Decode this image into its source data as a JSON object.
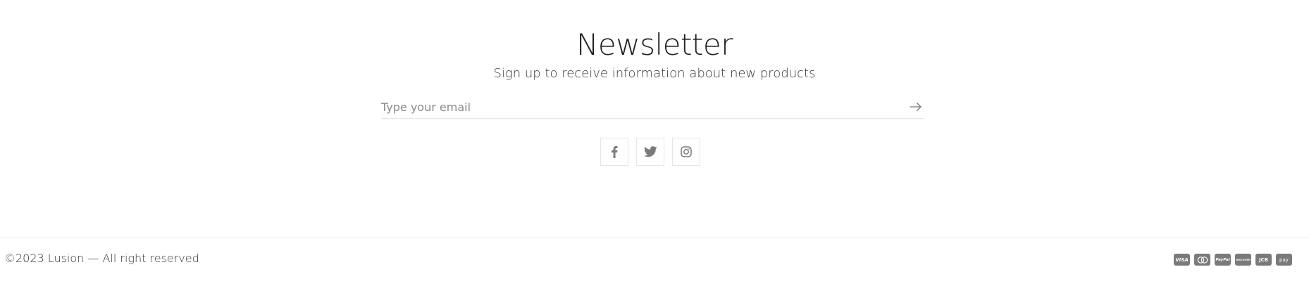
{
  "newsletter": {
    "title": "Newsletter",
    "subtitle": "Sign up to receive information about new products",
    "email_placeholder": "Type your email"
  },
  "social": {
    "items": [
      {
        "name": "facebook-icon"
      },
      {
        "name": "twitter-icon"
      },
      {
        "name": "instagram-icon"
      }
    ]
  },
  "footer": {
    "copyright": "©2023 Lusion — All right reserved",
    "payments": [
      {
        "label": "VISA",
        "icon": "visa-icon"
      },
      {
        "label": "",
        "icon": "mastercard-icon"
      },
      {
        "label": "PayPal",
        "icon": "paypal-icon"
      },
      {
        "label": "DISCOVER",
        "icon": "discover-icon"
      },
      {
        "label": "JCB",
        "icon": "jcb-icon"
      },
      {
        "label": "pay",
        "icon": "amazon-pay-icon"
      }
    ]
  },
  "colors": {
    "text": "#222222",
    "muted": "#8a8a8a",
    "border": "#e6e6e6",
    "icon": "#7a7a7a"
  }
}
